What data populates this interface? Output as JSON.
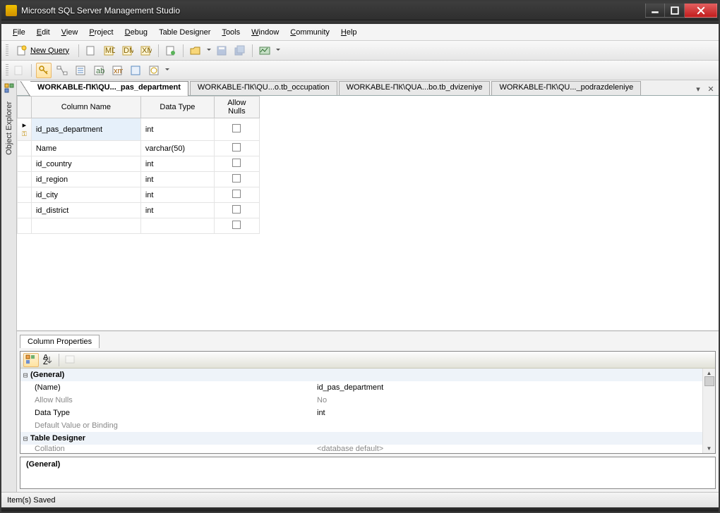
{
  "title": "Microsoft SQL Server Management Studio",
  "menu": {
    "file": "File",
    "edit": "Edit",
    "view": "View",
    "project": "Project",
    "debug": "Debug",
    "table_designer": "Table Designer",
    "tools": "Tools",
    "window": "Window",
    "community": "Community",
    "help": "Help"
  },
  "toolbar": {
    "new_query": "New Query"
  },
  "side": {
    "object_explorer": "Object Explorer"
  },
  "tabs": {
    "t1": "WORKABLE-ПК\\QU..._pas_department",
    "t2": "WORKABLE-ПК\\QU...o.tb_occupation",
    "t3": "WORKABLE-ПК\\QUA...bo.tb_dvizeniye",
    "t4": "WORKABLE-ПК\\QU..._podrazdeleniye"
  },
  "grid": {
    "h_name": "Column Name",
    "h_type": "Data Type",
    "h_null": "Allow Nulls",
    "rows": [
      {
        "name": "id_pas_department",
        "type": "int"
      },
      {
        "name": "Name",
        "type": "varchar(50)"
      },
      {
        "name": "id_country",
        "type": "int"
      },
      {
        "name": "id_region",
        "type": "int"
      },
      {
        "name": "id_city",
        "type": "int"
      },
      {
        "name": "id_district",
        "type": "int"
      }
    ]
  },
  "props": {
    "tab_label": "Column Properties",
    "cat_general": "(General)",
    "name_lbl": "(Name)",
    "name_val": "id_pas_department",
    "null_lbl": "Allow Nulls",
    "null_val": "No",
    "type_lbl": "Data Type",
    "type_val": "int",
    "default_lbl": "Default Value or Binding",
    "cat_td": "Table Designer",
    "coll_lbl": "Collation",
    "coll_val": "<database default>",
    "desc_title": "(General)"
  },
  "status": {
    "text": "Item(s) Saved"
  }
}
